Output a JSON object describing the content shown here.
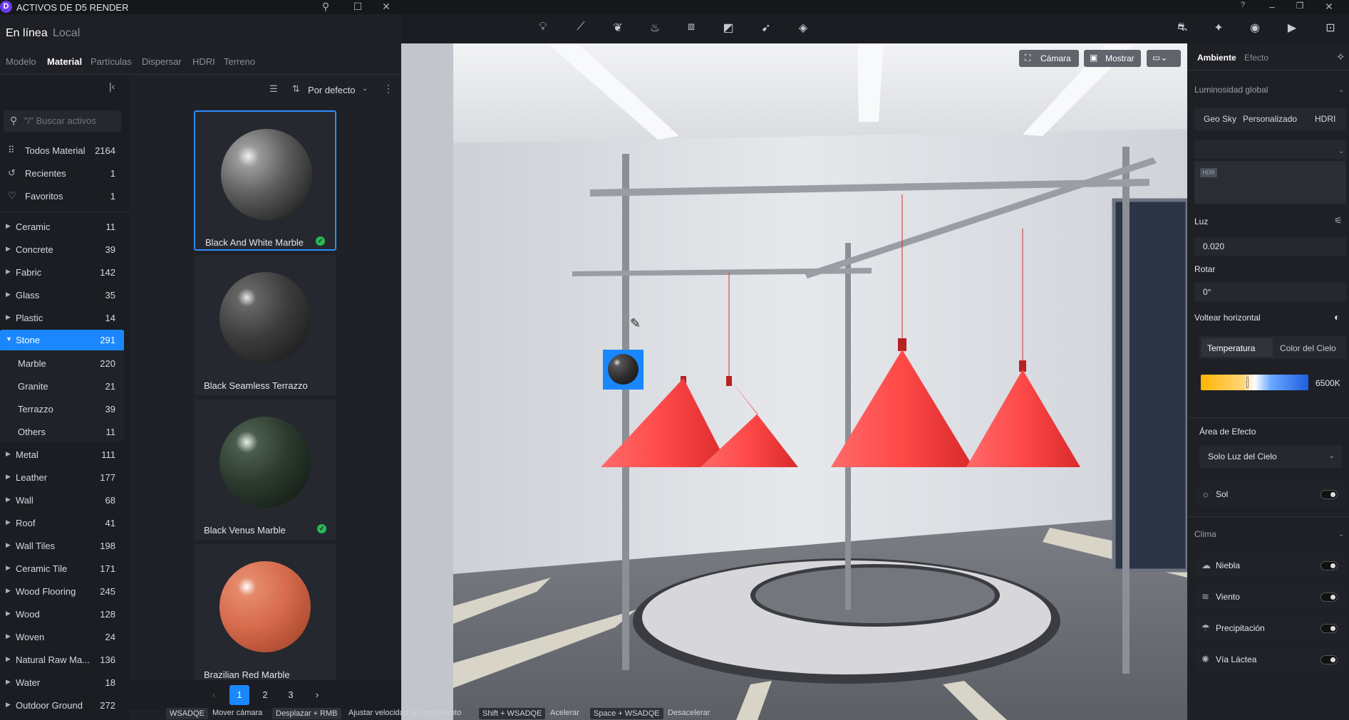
{
  "window": {
    "logo": "D",
    "title": "ACTIVOS DE D5 RENDER",
    "icons": [
      "pin-icon",
      "maximize-icon",
      "close-icon"
    ]
  },
  "source_tabs": [
    "En línea",
    "Local"
  ],
  "category_tabs": [
    "Modelo",
    "Material",
    "Partículas",
    "Dispersar",
    "HDRI",
    "Terreno"
  ],
  "search": {
    "placeholder": "\"/\" Buscar activos"
  },
  "sidebar": {
    "top_items": [
      {
        "label": "Todos Material",
        "count": "2164",
        "icon": "grid-icon"
      },
      {
        "label": "Recientes",
        "count": "1",
        "icon": "history-icon"
      },
      {
        "label": "Favoritos",
        "count": "1",
        "icon": "heart-icon"
      }
    ],
    "categories": [
      {
        "label": "Ceramic",
        "count": "11"
      },
      {
        "label": "Concrete",
        "count": "39"
      },
      {
        "label": "Fabric",
        "count": "142"
      },
      {
        "label": "Glass",
        "count": "35"
      },
      {
        "label": "Plastic",
        "count": "14"
      },
      {
        "label": "Stone",
        "count": "291"
      },
      {
        "label": "Metal",
        "count": "111"
      },
      {
        "label": "Leather",
        "count": "177"
      },
      {
        "label": "Wall",
        "count": "68"
      },
      {
        "label": "Roof",
        "count": "41"
      },
      {
        "label": "Wall Tiles",
        "count": "198"
      },
      {
        "label": "Ceramic Tile",
        "count": "171"
      },
      {
        "label": "Wood Flooring",
        "count": "245"
      },
      {
        "label": "Wood",
        "count": "128"
      },
      {
        "label": "Woven",
        "count": "24"
      },
      {
        "label": "Natural Raw Ma...",
        "count": "136"
      },
      {
        "label": "Water",
        "count": "18"
      },
      {
        "label": "Outdoor Ground",
        "count": "272"
      }
    ],
    "stone_sub": [
      {
        "label": "Marble",
        "count": "220"
      },
      {
        "label": "Granite",
        "count": "21"
      },
      {
        "label": "Terrazzo",
        "count": "39"
      },
      {
        "label": "Others",
        "count": "11"
      }
    ]
  },
  "grid_toolbar": {
    "sort_label": "Por defecto"
  },
  "materials": [
    {
      "name": "Black And White Marble",
      "downloaded": true
    },
    {
      "name": "Black Seamless Terrazzo",
      "downloaded": false
    },
    {
      "name": "Black Venus Marble",
      "downloaded": true
    },
    {
      "name": "Brazilian Red Marble",
      "downloaded": false
    }
  ],
  "pagination": {
    "pages": [
      "1",
      "2",
      "3"
    ],
    "current": "1"
  },
  "status_hints": [
    {
      "key": "WSADQE",
      "desc": "Mover cámara"
    },
    {
      "key": "Desplazar + RMB",
      "desc": "Ajustar velocidad de movimiento"
    },
    {
      "key": "Shift + WSADQE",
      "desc": "Acelerar"
    },
    {
      "key": "Space + WSADQE",
      "desc": "Desacelerar"
    }
  ],
  "viewport": {
    "camera_label": "Cámara",
    "show_label": "Mostrar"
  },
  "right_panel": {
    "tabs": [
      "Ambiente",
      "Efecto"
    ],
    "global_light": "Luminosidad global",
    "sky_modes": [
      "Geo Sky",
      "Personalizado",
      "HDRI"
    ],
    "hdr_badge": "HDR",
    "light_label": "Luz",
    "light_value": "0.020",
    "rotate_label": "Rotar",
    "rotate_value": "0°",
    "flip_label": "Voltear horizontal",
    "temp_tabs": [
      "Temperatura",
      "Color del Cielo"
    ],
    "temp_value": "6500K",
    "temperature_fraction": 0.43,
    "area_label": "Área de Efecto",
    "area_value": "Solo Luz del Cielo",
    "sun_label": "Sol",
    "climate_label": "Clima",
    "climate_items": [
      "Niebla",
      "Viento",
      "Precipitación",
      "Vía Láctea"
    ]
  },
  "colors": {
    "accent": "#1a87ff",
    "check": "#2bb855",
    "lamp": "#e83a3a"
  }
}
